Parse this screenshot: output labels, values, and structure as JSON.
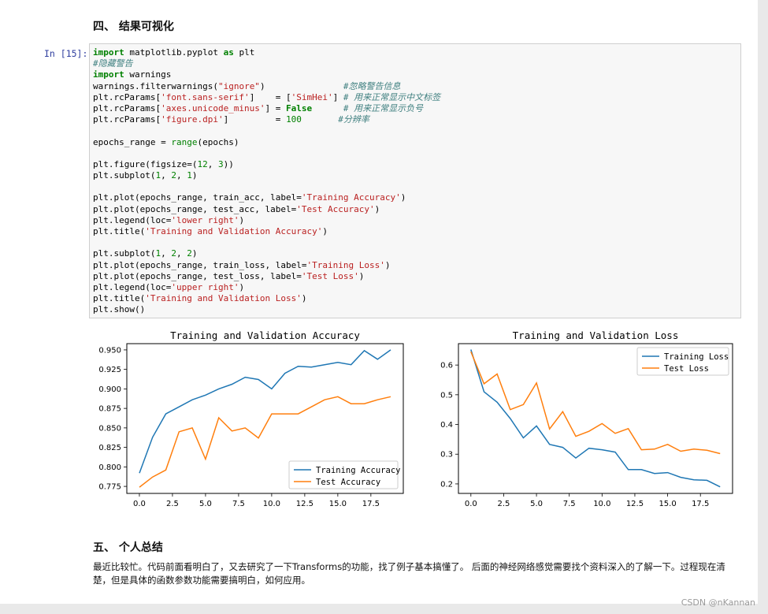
{
  "section4": {
    "title": "四、 结果可视化"
  },
  "cell": {
    "prompt": "In [15]:",
    "lines": [
      [
        [
          "kw",
          "import"
        ],
        [
          "t",
          " matplotlib.pyplot "
        ],
        [
          "kw",
          "as"
        ],
        [
          "t",
          " plt"
        ]
      ],
      [
        [
          "cmt",
          "#隐藏警告"
        ]
      ],
      [
        [
          "kw",
          "import"
        ],
        [
          "t",
          " warnings"
        ]
      ],
      [
        [
          "t",
          "warnings.filterwarnings("
        ],
        [
          "str",
          "\"ignore\""
        ],
        [
          "t",
          ")               "
        ],
        [
          "cmt",
          "#忽略警告信息"
        ]
      ],
      [
        [
          "t",
          "plt.rcParams["
        ],
        [
          "str",
          "'font.sans-serif'"
        ],
        [
          "t",
          "]    = ["
        ],
        [
          "str",
          "'SimHei'"
        ],
        [
          "t",
          "] "
        ],
        [
          "cmt",
          "# 用来正常显示中文标签"
        ]
      ],
      [
        [
          "t",
          "plt.rcParams["
        ],
        [
          "str",
          "'axes.unicode_minus'"
        ],
        [
          "t",
          "] = "
        ],
        [
          "kw",
          "False"
        ],
        [
          "t",
          "      "
        ],
        [
          "cmt",
          "# 用来正常显示负号"
        ]
      ],
      [
        [
          "t",
          "plt.rcParams["
        ],
        [
          "str",
          "'figure.dpi'"
        ],
        [
          "t",
          "]         = "
        ],
        [
          "num",
          "100"
        ],
        [
          "t",
          "       "
        ],
        [
          "cmt",
          "#分辨率"
        ]
      ],
      [],
      [
        [
          "t",
          "epochs_range = "
        ],
        [
          "num",
          "range"
        ],
        [
          "t",
          "(epochs)"
        ]
      ],
      [],
      [
        [
          "t",
          "plt.figure(figsize=("
        ],
        [
          "num",
          "12"
        ],
        [
          "t",
          ", "
        ],
        [
          "num",
          "3"
        ],
        [
          "t",
          "))"
        ]
      ],
      [
        [
          "t",
          "plt.subplot("
        ],
        [
          "num",
          "1"
        ],
        [
          "t",
          ", "
        ],
        [
          "num",
          "2"
        ],
        [
          "t",
          ", "
        ],
        [
          "num",
          "1"
        ],
        [
          "t",
          ")"
        ]
      ],
      [],
      [
        [
          "t",
          "plt.plot(epochs_range, train_acc, label="
        ],
        [
          "str",
          "'Training Accuracy'"
        ],
        [
          "t",
          ")"
        ]
      ],
      [
        [
          "t",
          "plt.plot(epochs_range, test_acc, label="
        ],
        [
          "str",
          "'Test Accuracy'"
        ],
        [
          "t",
          ")"
        ]
      ],
      [
        [
          "t",
          "plt.legend(loc="
        ],
        [
          "str",
          "'lower right'"
        ],
        [
          "t",
          ")"
        ]
      ],
      [
        [
          "t",
          "plt.title("
        ],
        [
          "str",
          "'Training and Validation Accuracy'"
        ],
        [
          "t",
          ")"
        ]
      ],
      [],
      [
        [
          "t",
          "plt.subplot("
        ],
        [
          "num",
          "1"
        ],
        [
          "t",
          ", "
        ],
        [
          "num",
          "2"
        ],
        [
          "t",
          ", "
        ],
        [
          "num",
          "2"
        ],
        [
          "t",
          ")"
        ]
      ],
      [
        [
          "t",
          "plt.plot(epochs_range, train_loss, label="
        ],
        [
          "str",
          "'Training Loss'"
        ],
        [
          "t",
          ")"
        ]
      ],
      [
        [
          "t",
          "plt.plot(epochs_range, test_loss, label="
        ],
        [
          "str",
          "'Test Loss'"
        ],
        [
          "t",
          ")"
        ]
      ],
      [
        [
          "t",
          "plt.legend(loc="
        ],
        [
          "str",
          "'upper right'"
        ],
        [
          "t",
          ")"
        ]
      ],
      [
        [
          "t",
          "plt.title("
        ],
        [
          "str",
          "'Training and Validation Loss'"
        ],
        [
          "t",
          ")"
        ]
      ],
      [
        [
          "t",
          "plt.show()"
        ]
      ]
    ]
  },
  "chart_data": [
    {
      "type": "line",
      "title": "Training and Validation Accuracy",
      "x": [
        0,
        1,
        2,
        3,
        4,
        5,
        6,
        7,
        8,
        9,
        10,
        11,
        12,
        13,
        14,
        15,
        16,
        17,
        18,
        19
      ],
      "xticks": [
        "0.0",
        "2.5",
        "5.0",
        "7.5",
        "10.0",
        "12.5",
        "15.0",
        "17.5"
      ],
      "yticks": [
        "0.775",
        "0.800",
        "0.825",
        "0.850",
        "0.875",
        "0.900",
        "0.925",
        "0.950"
      ],
      "xlim": [
        -0.95,
        19.95
      ],
      "ylim": [
        0.766,
        0.958
      ],
      "legend": "lower right",
      "series": [
        {
          "name": "Training Accuracy",
          "color": "#1f77b4",
          "values": [
            0.792,
            0.838,
            0.868,
            0.877,
            0.886,
            0.892,
            0.9,
            0.906,
            0.915,
            0.912,
            0.9,
            0.92,
            0.929,
            0.928,
            0.931,
            0.934,
            0.931,
            0.949,
            0.938,
            0.95
          ]
        },
        {
          "name": "Test Accuracy",
          "color": "#ff7f0e",
          "values": [
            0.774,
            0.787,
            0.796,
            0.845,
            0.85,
            0.81,
            0.863,
            0.846,
            0.85,
            0.837,
            0.868,
            0.868,
            0.868,
            0.877,
            0.886,
            0.89,
            0.881,
            0.881,
            0.886,
            0.89
          ]
        }
      ]
    },
    {
      "type": "line",
      "title": "Training and Validation Loss",
      "x": [
        0,
        1,
        2,
        3,
        4,
        5,
        6,
        7,
        8,
        9,
        10,
        11,
        12,
        13,
        14,
        15,
        16,
        17,
        18,
        19
      ],
      "xticks": [
        "0.0",
        "2.5",
        "5.0",
        "7.5",
        "10.0",
        "12.5",
        "15.0",
        "17.5"
      ],
      "yticks": [
        "0.2",
        "0.3",
        "0.4",
        "0.5",
        "0.6"
      ],
      "xlim": [
        -0.95,
        19.95
      ],
      "ylim": [
        0.168,
        0.672
      ],
      "legend": "upper right",
      "series": [
        {
          "name": "Training Loss",
          "color": "#1f77b4",
          "values": [
            0.652,
            0.51,
            0.475,
            0.42,
            0.355,
            0.395,
            0.333,
            0.323,
            0.287,
            0.32,
            0.315,
            0.307,
            0.248,
            0.248,
            0.235,
            0.238,
            0.222,
            0.214,
            0.212,
            0.19
          ]
        },
        {
          "name": "Test Loss",
          "color": "#ff7f0e",
          "values": [
            0.645,
            0.537,
            0.57,
            0.45,
            0.467,
            0.54,
            0.385,
            0.443,
            0.36,
            0.377,
            0.403,
            0.37,
            0.386,
            0.315,
            0.317,
            0.333,
            0.31,
            0.317,
            0.313,
            0.302
          ]
        }
      ]
    }
  ],
  "section5": {
    "title": "五、 个人总结",
    "body": "最近比较忙。代码前面看明白了，又去研究了一下Transforms的功能，找了例子基本搞懂了。 后面的神经网络感觉需要找个资料深入的了解一下。过程现在清楚，但是具体的函数参数功能需要搞明白，如何应用。"
  },
  "watermark": "CSDN @nKannan"
}
